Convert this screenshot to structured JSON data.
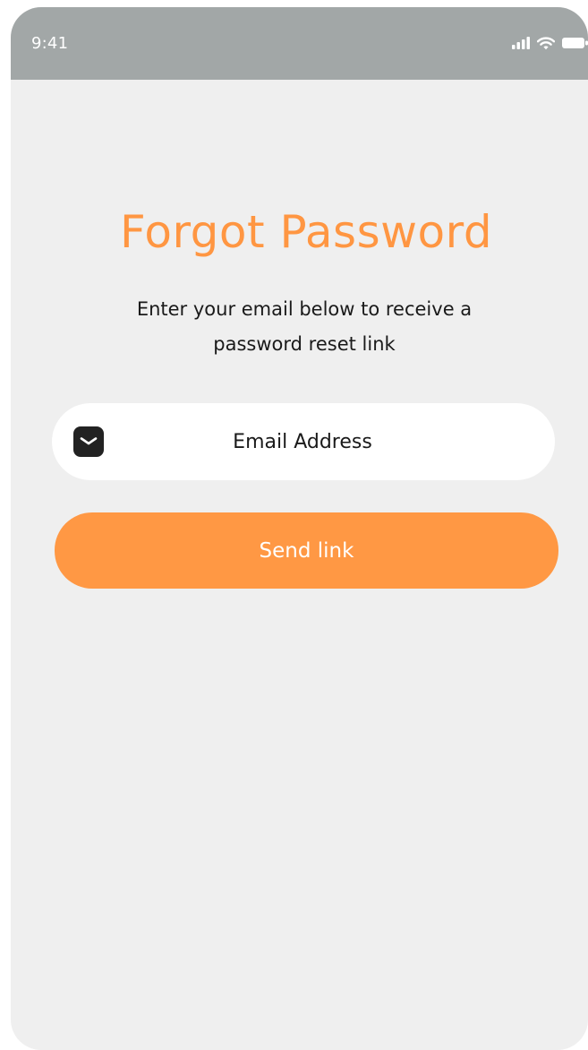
{
  "status_bar": {
    "time": "9:41",
    "icons": [
      "signal-icon",
      "wifi-icon",
      "battery-icon"
    ]
  },
  "page": {
    "title": "Forgot Password",
    "subtitle_line1": "Enter your email below to receive a",
    "subtitle_line2": "password reset link"
  },
  "email_field": {
    "icon": "mail-icon",
    "value": "",
    "placeholder": "Email Address"
  },
  "send_button": {
    "label": "Send link"
  },
  "colors": {
    "accent": "#ff9642",
    "status_bar": "#a2a7a7",
    "background": "#efefef",
    "field": "#ffffff",
    "text": "#1a1a1a"
  }
}
